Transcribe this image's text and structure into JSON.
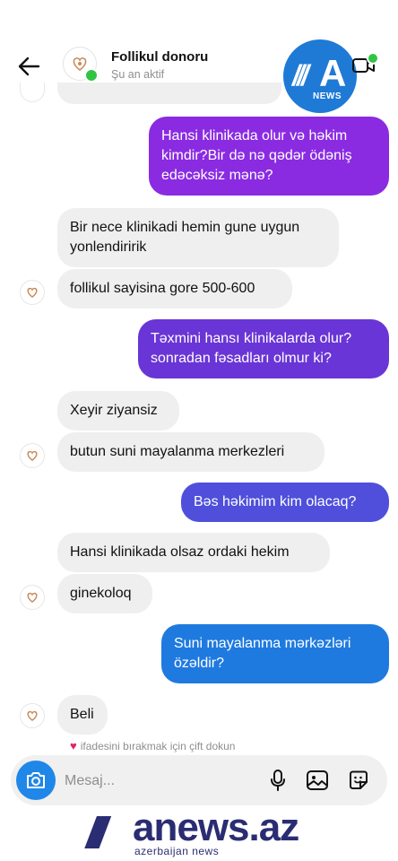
{
  "header": {
    "contact_name": "Follikul donoru",
    "status": "Şu an aktif",
    "news_logo_word": "NEWS",
    "news_logo_letter": "A",
    "news_logo_lines": "///"
  },
  "messages": [
    {
      "side": "out",
      "text": "Hansi klinikada olur və həkim kimdir?Bir də nə qədər ödəniş edəcəksiz mənə?"
    },
    {
      "side": "in",
      "text": "Bir nece klinikadi hemin gune uygun yonlendiririk"
    },
    {
      "side": "in",
      "text": "follikul sayisina gore 500-600"
    },
    {
      "side": "out",
      "text": "Təxmini hansı klinikalarda olur? sonradan fəsadları olmur ki?"
    },
    {
      "side": "in",
      "text": "Xeyir ziyansiz"
    },
    {
      "side": "in",
      "text": "butun suni mayalanma merkezleri"
    },
    {
      "side": "out",
      "text": "Bəs həkimim kim olacaq?"
    },
    {
      "side": "in",
      "text": "Hansi klinikada olsaz ordaki hekim"
    },
    {
      "side": "in",
      "text": "ginekoloq"
    },
    {
      "side": "out",
      "text": "Suni mayalanma mərkəzləri özəldir?"
    },
    {
      "side": "in",
      "text": "Beli"
    }
  ],
  "hint": "ifadesini bırakmak için çift dokun",
  "composer": {
    "placeholder": "Mesaj..."
  },
  "footer": {
    "lines": "///",
    "word": "anews.az",
    "sub": "azerbaijan news"
  },
  "colors": {
    "purple": "#8a2be2",
    "violet": "#6a35d6",
    "indigo": "#4f4fdc",
    "blue": "#1f7ae0",
    "online": "#31c443"
  }
}
